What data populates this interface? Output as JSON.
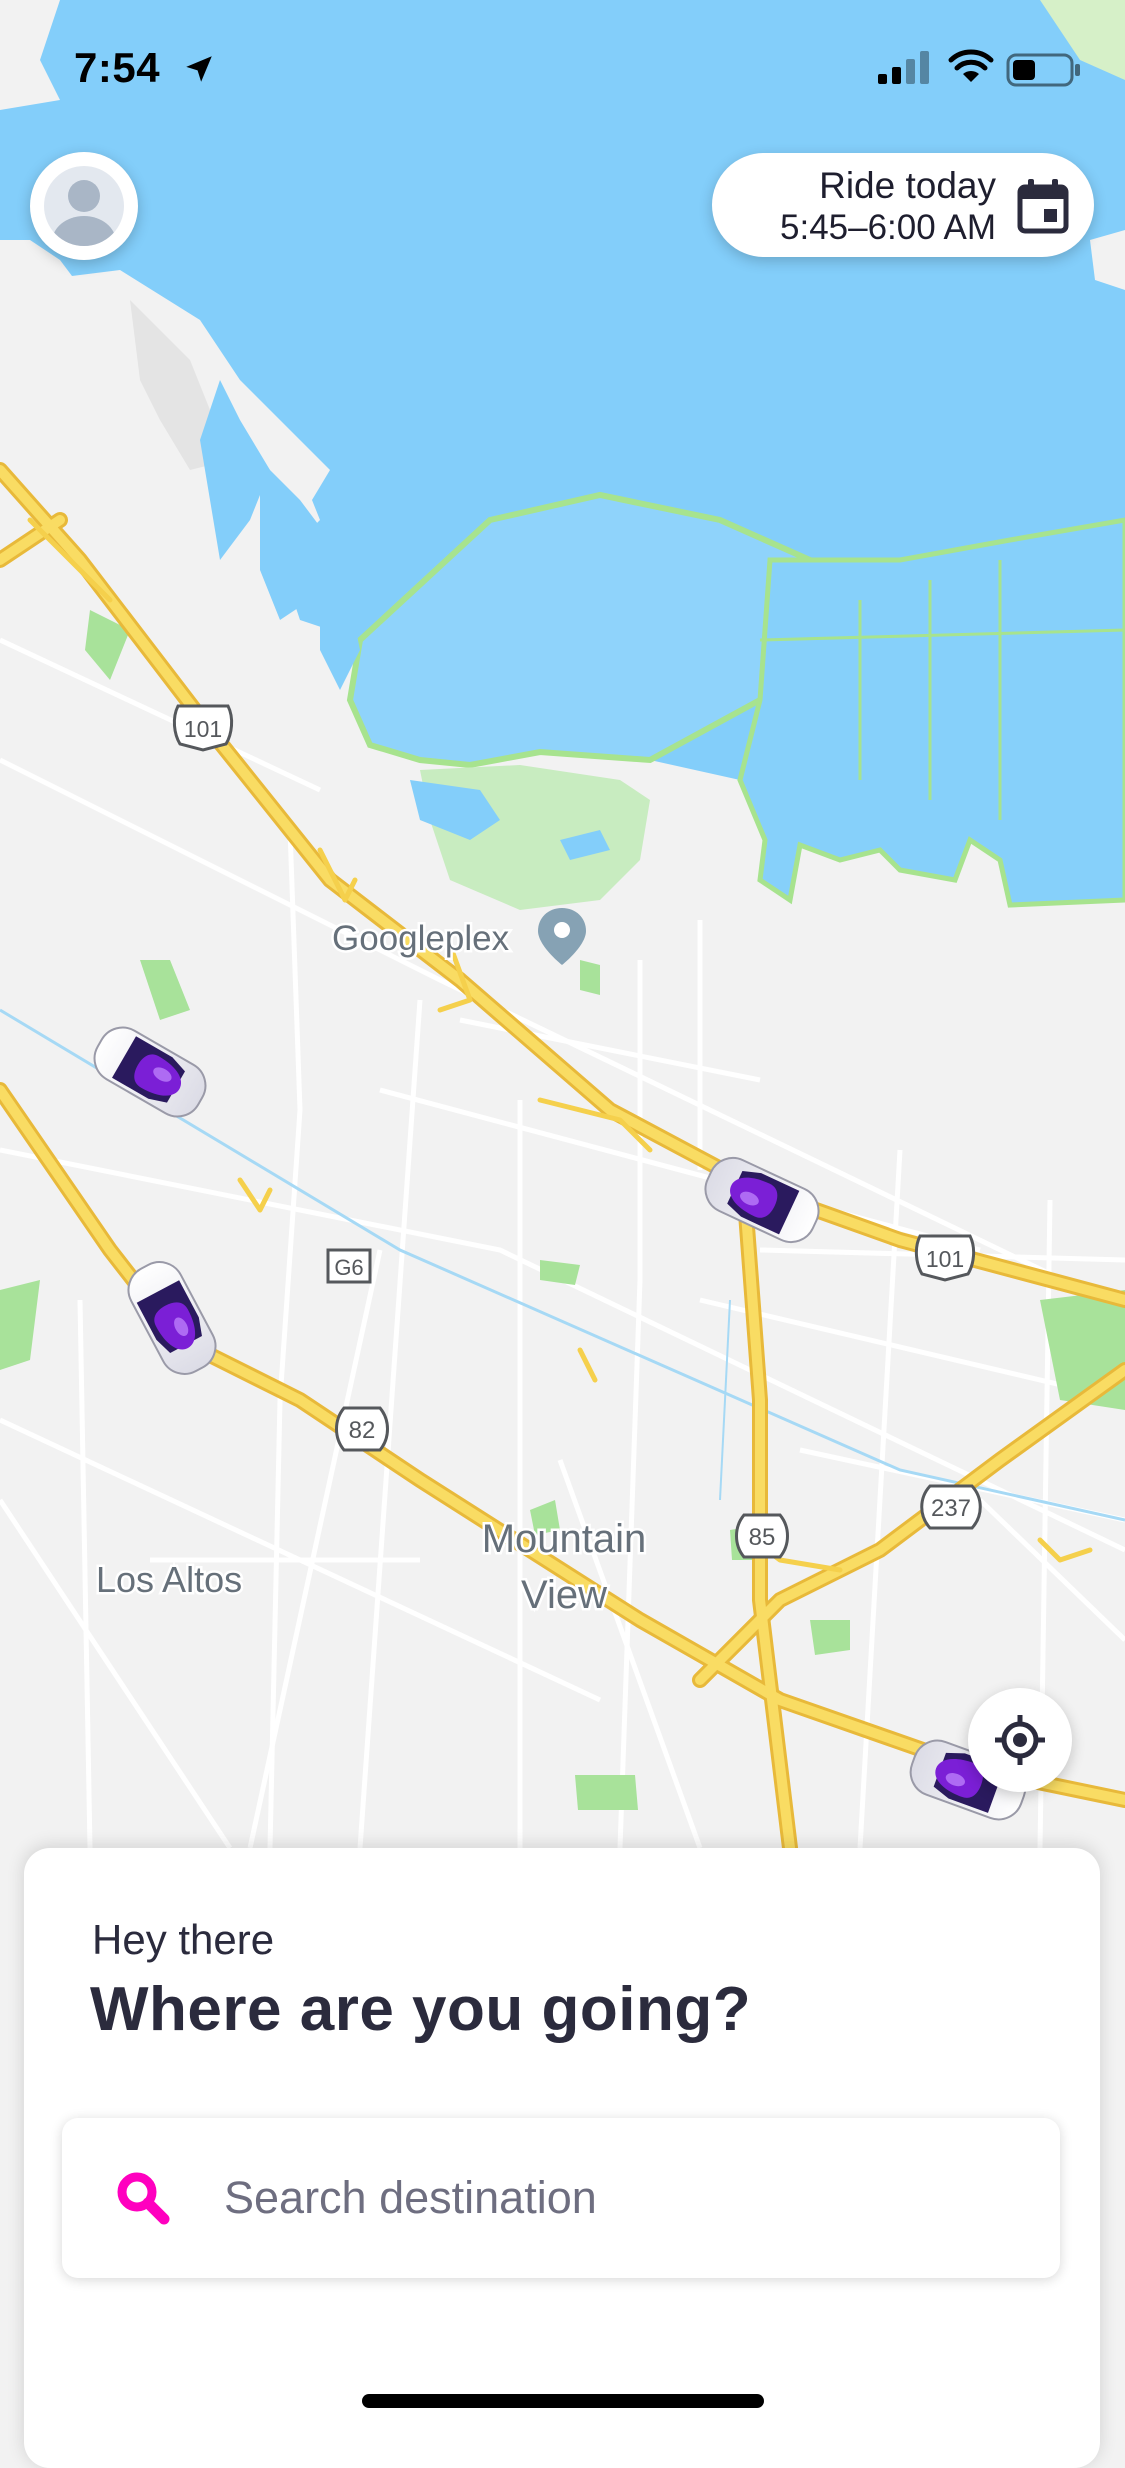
{
  "status_bar": {
    "time": "7:54",
    "icons": [
      "location-arrow-icon",
      "cellular-signal-icon",
      "wifi-icon",
      "battery-icon"
    ]
  },
  "header": {
    "avatar_icon": "user-avatar-icon",
    "ride": {
      "title": "Ride today",
      "time": "5:45–6:00 AM",
      "icon": "calendar-icon"
    }
  },
  "map": {
    "labels": {
      "googleplex": "Googleplex",
      "mountain_view_line1": "Mountain",
      "mountain_view_line2": "View",
      "los_altos": "Los Altos"
    },
    "shields": {
      "us101_north": "101",
      "us101_east": "101",
      "g6": "G6",
      "sr82": "82",
      "sr85": "85",
      "sr237": "237"
    },
    "cars_count": 4,
    "locate_icon": "crosshair-locate-icon",
    "colors": {
      "water": "#83cefa",
      "land": "#f2f2f2",
      "park": "#c8ecc0",
      "highway": "#f6d24a",
      "car_accent": "#7b1fd6"
    }
  },
  "sheet": {
    "greeting": "Hey there",
    "headline": "Where are you going?",
    "search": {
      "placeholder": "Search destination",
      "icon": "search-icon",
      "icon_color": "#ff00bf"
    }
  }
}
